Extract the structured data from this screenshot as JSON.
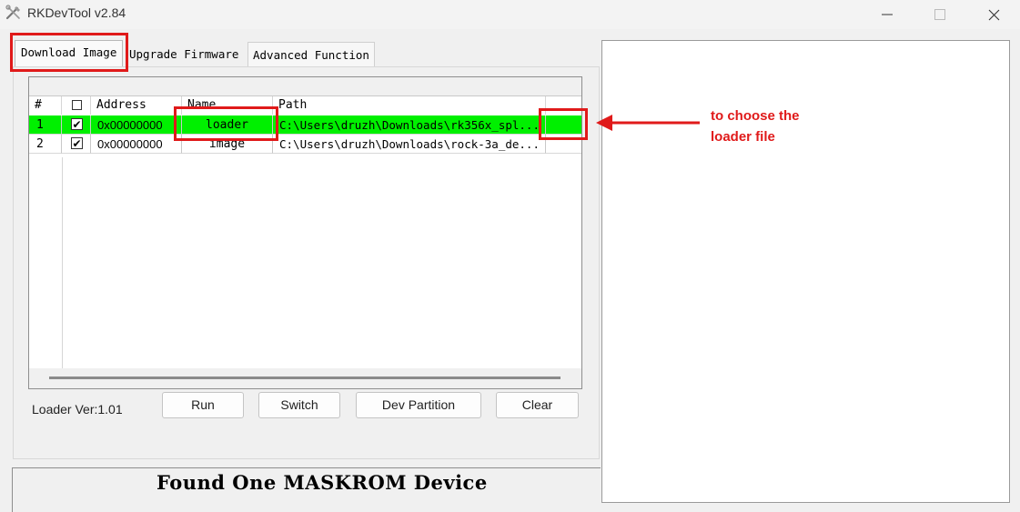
{
  "window": {
    "title": "RKDevTool v2.84",
    "minimize_glyph": "—",
    "maximize_glyph": "☐",
    "close_glyph": "✕"
  },
  "tabs": [
    {
      "label": "Download Image",
      "active": true
    },
    {
      "label": "Upgrade Firmware",
      "active": false
    },
    {
      "label": "Advanced Function",
      "active": false
    }
  ],
  "table": {
    "headers": {
      "num": "#",
      "check": "",
      "address": "Address",
      "name": "Name",
      "path": "Path"
    },
    "rows": [
      {
        "num": "1",
        "checked": "✔",
        "address": "0x00000000",
        "name": "loader",
        "path": "C:\\Users\\druzh\\Downloads\\rk356x_spl...",
        "selected": true
      },
      {
        "num": "2",
        "checked": "✔",
        "address": "0x00000000",
        "name": "image",
        "path": "C:\\Users\\druzh\\Downloads\\rock-3a_de...",
        "selected": false
      }
    ]
  },
  "loader_version": "Loader Ver:1.01",
  "buttons": {
    "run": "Run",
    "switch": "Switch",
    "dev_partition": "Dev Partition",
    "clear": "Clear"
  },
  "status": "Found One MASKROM Device",
  "annotation": {
    "line1": "to choose the",
    "line2": "loader file",
    "color": "#e01a1a"
  },
  "colors": {
    "selected_row": "#00f000",
    "annotation_red": "#e01a1a"
  },
  "icons": {
    "app": "tools-icon",
    "checkbox": "checkbox-icon"
  }
}
